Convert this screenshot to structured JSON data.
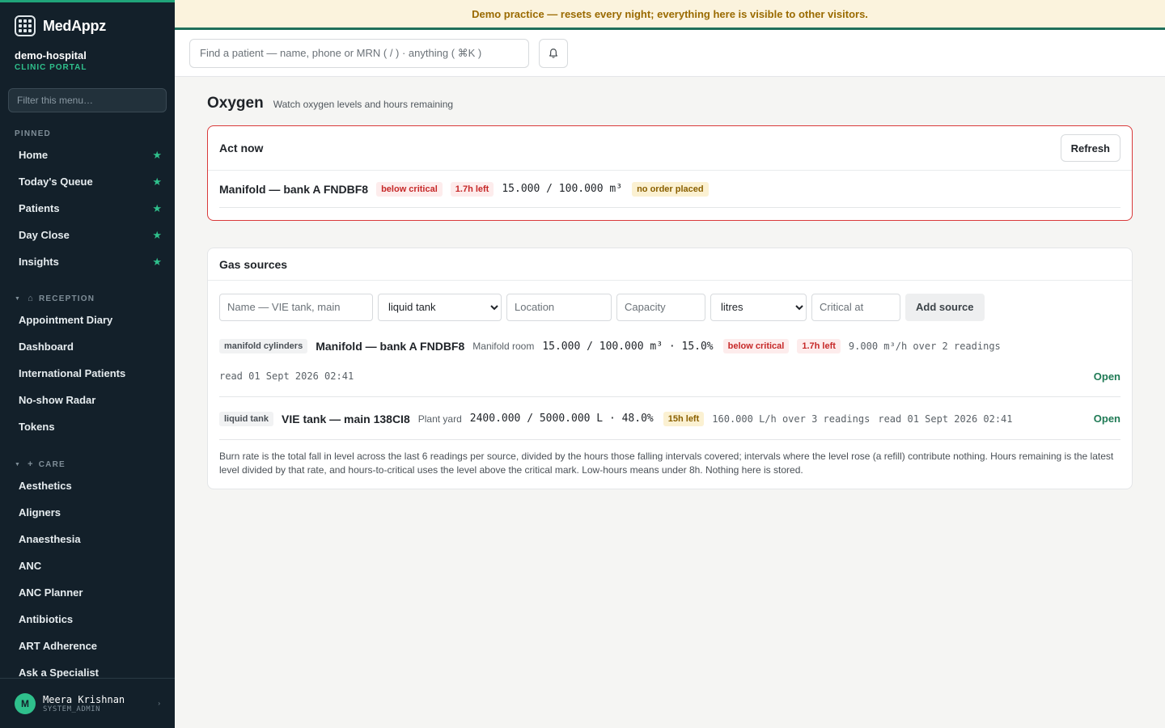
{
  "brand": {
    "name": "MedAppz"
  },
  "org": {
    "name": "demo-hospital",
    "subtitle": "CLINIC PORTAL"
  },
  "sidebar": {
    "filter_placeholder": "Filter this menu…",
    "pinned": {
      "title": "PINNED",
      "items": [
        {
          "label": "Home"
        },
        {
          "label": "Today's Queue"
        },
        {
          "label": "Patients"
        },
        {
          "label": "Day Close"
        },
        {
          "label": "Insights"
        }
      ]
    },
    "reception": {
      "title": "RECEPTION",
      "items": [
        {
          "label": "Appointment Diary"
        },
        {
          "label": "Dashboard"
        },
        {
          "label": "International Patients"
        },
        {
          "label": "No-show Radar"
        },
        {
          "label": "Tokens"
        }
      ]
    },
    "care": {
      "title": "CARE",
      "items": [
        {
          "label": "Aesthetics"
        },
        {
          "label": "Aligners"
        },
        {
          "label": "Anaesthesia"
        },
        {
          "label": "ANC"
        },
        {
          "label": "ANC Planner"
        },
        {
          "label": "Antibiotics"
        },
        {
          "label": "ART Adherence"
        },
        {
          "label": "Ask a Specialist"
        }
      ]
    }
  },
  "user": {
    "initial": "M",
    "name": "Meera Krishnan",
    "role": "SYSTEM_ADMIN"
  },
  "banner": {
    "text": "Demo practice — resets every night; everything here is visible to other visitors."
  },
  "topbar": {
    "search_placeholder": "Find a patient — name, phone or MRN ( / ) · anything ( ⌘K )"
  },
  "page": {
    "title": "Oxygen",
    "subtitle": "Watch oxygen levels and hours remaining"
  },
  "act_now": {
    "title": "Act now",
    "refresh_label": "Refresh",
    "alert": {
      "name": "Manifold — bank A FNDBF8",
      "status": "below critical",
      "left": "1.7h left",
      "level": "15.000 / 100.000 m³",
      "order": "no order placed"
    }
  },
  "gas_sources": {
    "title": "Gas sources",
    "form": {
      "name_placeholder": "Name — VIE tank, main",
      "type_value": "liquid tank",
      "location_placeholder": "Location",
      "capacity_placeholder": "Capacity",
      "unit_value": "litres",
      "critical_placeholder": "Critical at",
      "add_label": "Add source"
    },
    "sources": [
      {
        "type": "manifold cylinders",
        "name": "Manifold — bank A FNDBF8",
        "location": "Manifold room",
        "level": "15.000 / 100.000 m³ · 15.0%",
        "status": "below critical",
        "left": "1.7h left",
        "rate": "9.000 m³/h over 2 readings",
        "read": "read 01 Sept 2026 02:41",
        "open_label": "Open"
      },
      {
        "type": "liquid tank",
        "name": "VIE tank — main 138CI8",
        "location": "Plant yard",
        "level": "2400.000 / 5000.000 L · 48.0%",
        "left": "15h left",
        "rate": "160.000 L/h over 3 readings",
        "read": "read 01 Sept 2026 02:41",
        "open_label": "Open"
      }
    ],
    "note": "Burn rate is the total fall in level across the last 6 readings per source, divided by the hours those falling intervals covered; intervals where the level rose (a refill) contribute nothing. Hours remaining is the latest level divided by that rate, and hours-to-critical uses the level above the critical mark. Low-hours means under 8h. Nothing here is stored."
  },
  "colors": {
    "accent": "#20a47a",
    "sidebar_bg": "#13202a",
    "danger": "#d93a3a",
    "link": "#1f7a55"
  }
}
